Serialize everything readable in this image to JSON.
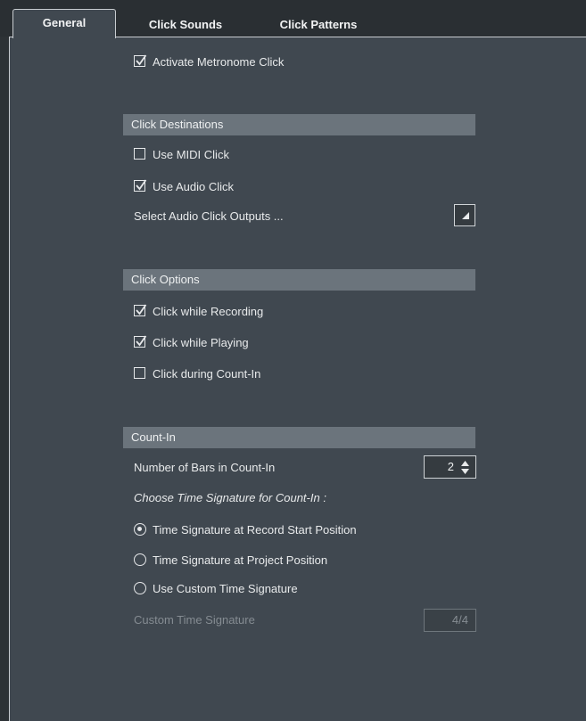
{
  "tabs": [
    {
      "label": "General",
      "active": true
    },
    {
      "label": "Click Sounds",
      "active": false
    },
    {
      "label": "Click Patterns",
      "active": false
    }
  ],
  "activate_metronome": {
    "label": "Activate Metronome Click",
    "checked": true
  },
  "click_destinations": {
    "header": "Click Destinations",
    "use_midi_click": {
      "label": "Use MIDI Click",
      "checked": false
    },
    "use_audio_click": {
      "label": "Use Audio Click",
      "checked": true
    },
    "select_outputs_label": "Select Audio Click Outputs ..."
  },
  "click_options": {
    "header": "Click Options",
    "while_recording": {
      "label": "Click while Recording",
      "checked": true
    },
    "while_playing": {
      "label": "Click while Playing",
      "checked": true
    },
    "during_count_in": {
      "label": "Click during Count-In",
      "checked": false
    }
  },
  "count_in": {
    "header": "Count-In",
    "bars_label": "Number of Bars in Count-In",
    "bars_value": "2",
    "time_sig_prompt": "Choose Time Signature for Count-In :",
    "options": [
      {
        "label": "Time Signature at Record Start Position",
        "selected": true
      },
      {
        "label": "Time Signature at Project Position",
        "selected": false
      },
      {
        "label": "Use Custom Time Signature",
        "selected": false
      }
    ],
    "custom_label": "Custom Time Signature",
    "custom_value": "4/4"
  },
  "colors": {
    "background": "#2d3236",
    "panel": "#404850",
    "section_header": "#6b747c",
    "text": "#e8eaeb",
    "disabled_text": "#858c92"
  }
}
